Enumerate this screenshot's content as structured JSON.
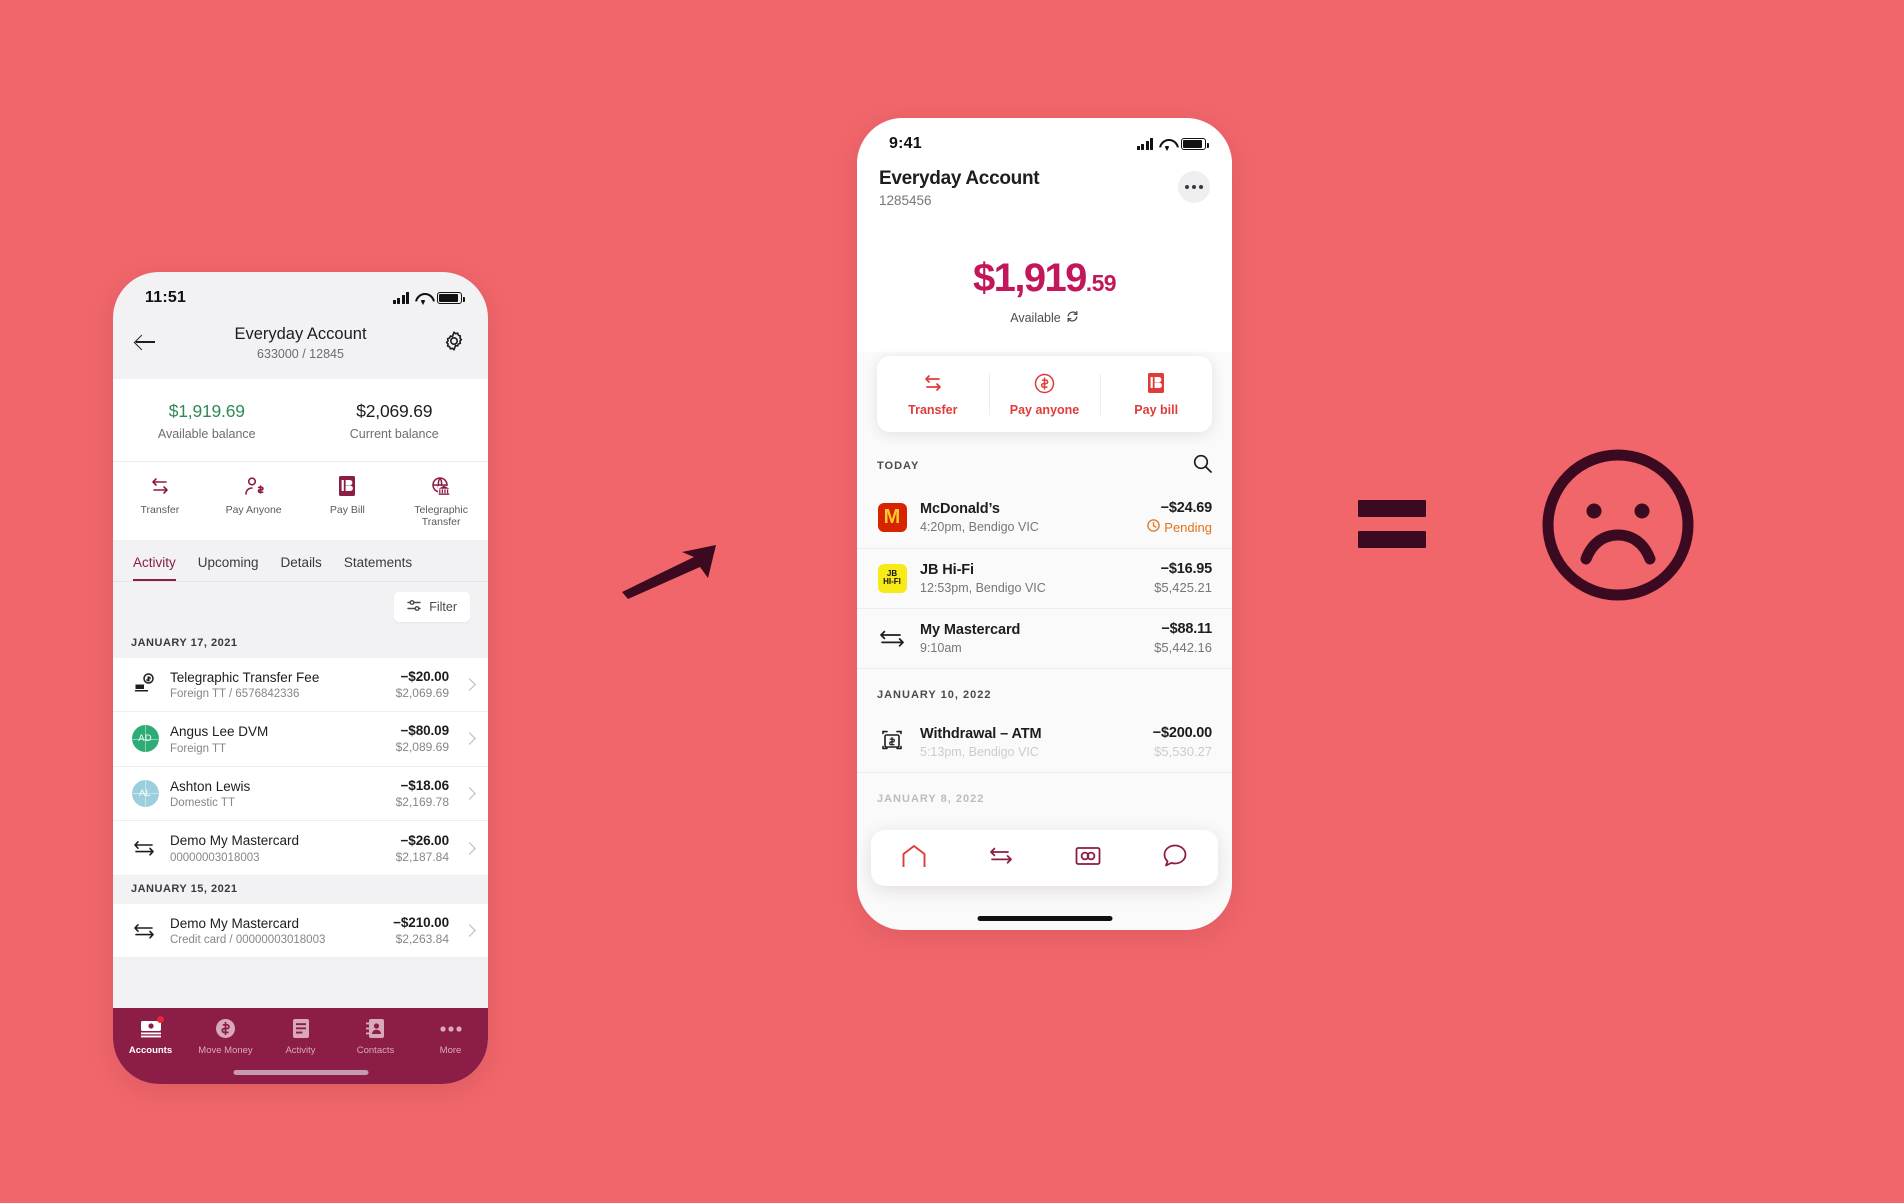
{
  "canvas": {
    "background": "#f0666b",
    "accent_maroon": "#8b1d46",
    "accent_red": "#e03b3b",
    "accent_pink": "#c2185b"
  },
  "left_phone": {
    "status": {
      "time": "11:51",
      "signal_icon": "signal-bars-icon",
      "wifi_icon": "wifi-icon",
      "battery_icon": "battery-icon"
    },
    "header": {
      "back_icon": "back-arrow-icon",
      "title": "Everyday Account",
      "subtitle": "633000 / 12845",
      "settings_icon": "gear-icon"
    },
    "balances": [
      {
        "amount": "$1,919.69",
        "label": "Available balance",
        "color": "green"
      },
      {
        "amount": "$2,069.69",
        "label": "Current balance",
        "color": "dark"
      }
    ],
    "actions": [
      {
        "label": "Transfer",
        "icon": "transfer-arrows-icon"
      },
      {
        "label": "Pay Anyone",
        "icon": "person-dollar-icon"
      },
      {
        "label": "Pay Bill",
        "icon": "bpay-icon"
      },
      {
        "label": "Telegraphic Transfer",
        "icon": "globe-bank-icon"
      }
    ],
    "tabs": [
      {
        "label": "Activity",
        "active": true
      },
      {
        "label": "Upcoming",
        "active": false
      },
      {
        "label": "Details",
        "active": false
      },
      {
        "label": "Statements",
        "active": false
      }
    ],
    "filter": {
      "label": "Filter",
      "icon": "filter-sliders-icon"
    },
    "groups": [
      {
        "date": "JANUARY 17, 2021",
        "rows": [
          {
            "icon": "fee-receipt-icon",
            "avatar": null,
            "name": "Telegraphic Transfer Fee",
            "sub": "Foreign TT / 6576842336",
            "amount": "−$20.00",
            "running": "$2,069.69"
          },
          {
            "icon": "avatar",
            "avatar": {
              "initials": "AD",
              "color": "#2eac76"
            },
            "name": "Angus Lee DVM",
            "sub": "Foreign TT",
            "amount": "−$80.09",
            "running": "$2,089.69"
          },
          {
            "icon": "avatar",
            "avatar": {
              "initials": "AL",
              "color": "#9ccfdd"
            },
            "name": "Ashton Lewis",
            "sub": "Domestic TT",
            "amount": "−$18.06",
            "running": "$2,169.78"
          },
          {
            "icon": "transfer-arrows-icon",
            "avatar": null,
            "name": "Demo My Mastercard",
            "sub": "00000003018003",
            "amount": "−$26.00",
            "running": "$2,187.84"
          }
        ]
      },
      {
        "date": "JANUARY 15, 2021",
        "rows": [
          {
            "icon": "transfer-arrows-icon",
            "avatar": null,
            "name": "Demo My Mastercard",
            "sub": "Credit card / 00000003018003",
            "amount": "−$210.00",
            "running": "$2,263.84"
          }
        ]
      }
    ],
    "bottom_nav": [
      {
        "label": "Accounts",
        "icon": "accounts-cash-icon",
        "active": true,
        "badge": true
      },
      {
        "label": "Move Money",
        "icon": "dollar-circle-icon",
        "active": false,
        "badge": false
      },
      {
        "label": "Activity",
        "icon": "list-lines-icon",
        "active": false,
        "badge": false
      },
      {
        "label": "Contacts",
        "icon": "contact-book-icon",
        "active": false,
        "badge": false
      },
      {
        "label": "More",
        "icon": "ellipsis-icon",
        "active": false,
        "badge": false
      }
    ]
  },
  "right_phone": {
    "status": {
      "time": "9:41",
      "signal_icon": "signal-bars-icon",
      "wifi_icon": "wifi-icon",
      "battery_icon": "battery-icon"
    },
    "header": {
      "title": "Everyday Account",
      "subtitle": "1285456",
      "more_icon": "ellipsis-circle-icon"
    },
    "balance": {
      "whole": "$1,919",
      "cents": ".59",
      "available_label": "Available",
      "refresh_icon": "refresh-icon"
    },
    "actions": [
      {
        "label": "Transfer",
        "icon": "transfer-arrows-icon"
      },
      {
        "label": "Pay anyone",
        "icon": "dollar-circle-icon"
      },
      {
        "label": "Pay bill",
        "icon": "bpay-icon"
      }
    ],
    "section": {
      "label": "TODAY",
      "search_icon": "search-icon"
    },
    "today_rows": [
      {
        "logo": "mcdonalds",
        "name": "McDonald’s",
        "sub": "4:20pm, Bendigo VIC",
        "amount": "−$24.69",
        "status": "Pending",
        "status_icon": "clock-icon",
        "running": null
      },
      {
        "logo": "jbhifi",
        "name": "JB Hi-Fi",
        "sub": "12:53pm, Bendigo VIC",
        "amount": "−$16.95",
        "status": null,
        "status_icon": null,
        "running": "$5,425.21"
      },
      {
        "logo": "transfer-arrows-icon",
        "name": "My Mastercard",
        "sub": "9:10am",
        "amount": "−$88.11",
        "status": null,
        "status_icon": null,
        "running": "$5,442.16"
      }
    ],
    "next_group": {
      "date": "JANUARY 10, 2022",
      "rows": [
        {
          "logo": "atm-icon",
          "name": "Withdrawal – ATM",
          "sub": "5:13pm, Bendigo VIC",
          "amount": "−$200.00",
          "running": "$5,530.27"
        }
      ]
    },
    "clipped_date": "JANUARY 8, 2022",
    "float_nav": [
      {
        "icon": "home-icon",
        "active": true
      },
      {
        "icon": "transfer-arrows-icon",
        "active": false
      },
      {
        "icon": "cards-icon",
        "active": false
      },
      {
        "icon": "chat-bubble-icon",
        "active": false
      }
    ]
  },
  "annotations": {
    "arrow_icon": "hand-drawn-arrow-icon",
    "equals_icon": "equals-sign-icon",
    "face_icon": "sad-face-icon"
  }
}
